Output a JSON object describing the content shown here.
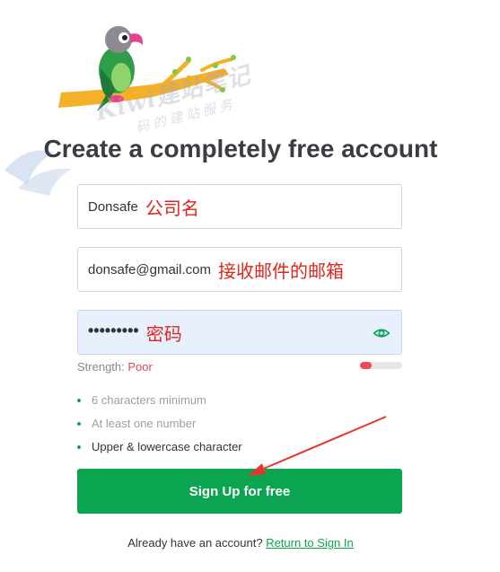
{
  "title": "Create a completely free account",
  "watermark": {
    "text": "Kiwi建站笔记",
    "subtext": "码的建站服务"
  },
  "form": {
    "company": {
      "value": "Donsafe",
      "annotation": "公司名"
    },
    "email": {
      "value": "donsafe@gmail.com",
      "annotation": "接收邮件的邮箱"
    },
    "password": {
      "masked_value": "•••••••••",
      "annotation": "密码"
    }
  },
  "strength": {
    "label": "Strength:",
    "value": "Poor",
    "level": 0.28
  },
  "requirements": [
    {
      "text": "6 characters minimum",
      "met": false
    },
    {
      "text": "At least one number",
      "met": false
    },
    {
      "text": "Upper & lowercase character",
      "met": true
    }
  ],
  "signup_button": "Sign Up for free",
  "footer": {
    "prompt": "Already have an account?",
    "link": "Return to Sign In"
  },
  "colors": {
    "accent": "#0ba451",
    "annotation": "#e0261c",
    "weak": "#ef4a5c"
  }
}
